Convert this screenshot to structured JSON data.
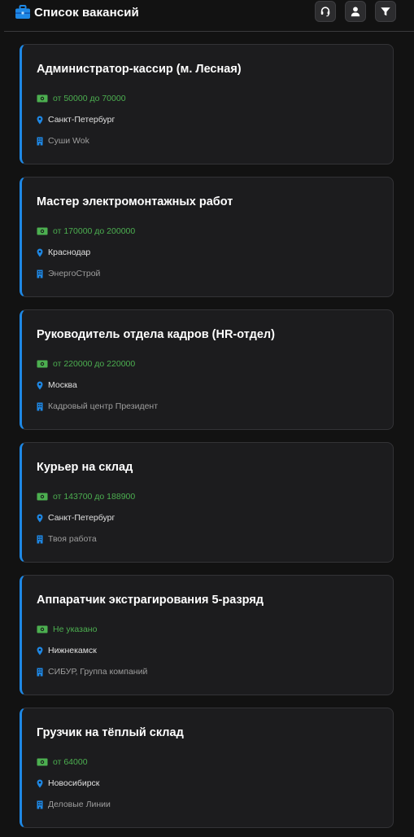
{
  "header": {
    "title": "Список вакансий",
    "icon": "briefcase-icon",
    "buttons": [
      "support-icon",
      "user-icon",
      "filter-icon"
    ]
  },
  "colors": {
    "accent": "#1e88e5",
    "salary": "#4caf50",
    "background": "#121212",
    "card": "#1c1c1e"
  },
  "vacancies": [
    {
      "title": "Администратор-кассир (м. Лесная)",
      "salary": "от 50000 до 70000",
      "city": "Санкт-Петербург",
      "company": "Суши Wok"
    },
    {
      "title": "Мастер электромонтажных работ",
      "salary": "от 170000 до 200000",
      "city": "Краснодар",
      "company": "ЭнергоСтрой"
    },
    {
      "title": "Руководитель отдела кадров (HR-отдел)",
      "salary": "от 220000 до 220000",
      "city": "Москва",
      "company": "Кадровый центр Президент"
    },
    {
      "title": "Курьер на склад",
      "salary": "от 143700 до 188900",
      "city": "Санкт-Петербург",
      "company": "Твоя работа"
    },
    {
      "title": "Аппаратчик экстрагирования 5-разряд",
      "salary": "Не указано",
      "city": "Нижнекамск",
      "company": "СИБУР, Группа компаний"
    },
    {
      "title": "Грузчик на тёплый склад",
      "salary": "от 64000",
      "city": "Новосибирск",
      "company": "Деловые Линии"
    }
  ]
}
